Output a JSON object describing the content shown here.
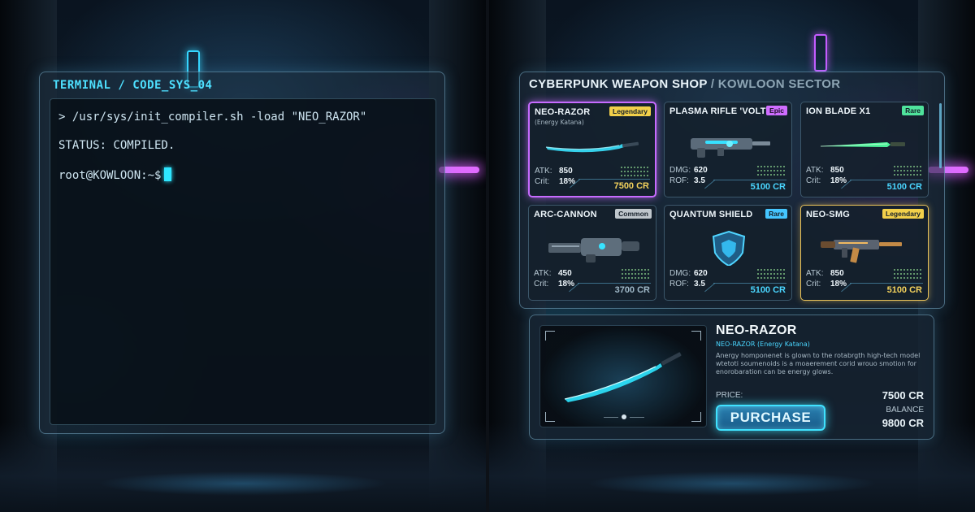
{
  "terminal": {
    "title": "TERMINAL / CODE_SYS_04",
    "lines": [
      "> /usr/sys/init_compiler.sh -load \"NEO_RAZOR\"",
      "STATUS: COMPILED.",
      "root@KOWLOON:~$"
    ]
  },
  "shop": {
    "title_main": "CYBERPUNK WEAPON SHOP",
    "title_sep": " / KOWLOON SECTOR",
    "items": [
      {
        "name": "NEO-RAZOR",
        "subtitle": "(Energy Katana)",
        "badge": "Legendary",
        "stat1_label": "ATK:",
        "stat1_value": "850",
        "stat2_label": "Crit:",
        "stat2_value": "18%",
        "price": "7500 CR",
        "icon": "katana-icon"
      },
      {
        "name": "PLASMA RIFLE 'VOLT'",
        "subtitle": "",
        "badge": "Epic",
        "stat1_label": "DMG:",
        "stat1_value": "620",
        "stat2_label": "ROF:",
        "stat2_value": "3.5",
        "price": "5100 CR",
        "icon": "rifle-icon"
      },
      {
        "name": "ION BLADE X1",
        "subtitle": "",
        "badge": "Rare",
        "stat1_label": "ATK:",
        "stat1_value": "850",
        "stat2_label": "Crit:",
        "stat2_value": "18%",
        "price": "5100 CR",
        "icon": "blade-icon"
      },
      {
        "name": "ARC-CANNON",
        "subtitle": "",
        "badge": "Common",
        "stat1_label": "ATK:",
        "stat1_value": "450",
        "stat2_label": "Crit:",
        "stat2_value": "18%",
        "price": "3700 CR",
        "icon": "cannon-icon"
      },
      {
        "name": "QUANTUM SHIELD",
        "subtitle": "",
        "badge": "Rare",
        "stat1_label": "DMG:",
        "stat1_value": "620",
        "stat2_label": "ROF:",
        "stat2_value": "3.5",
        "price": "5100 CR",
        "icon": "shield-icon"
      },
      {
        "name": "NEO-SMG",
        "subtitle": "",
        "badge": "Legendary",
        "stat1_label": "ATK:",
        "stat1_value": "850",
        "stat2_label": "Crit:",
        "stat2_value": "18%",
        "price": "5100 CR",
        "icon": "smg-icon"
      }
    ]
  },
  "detail": {
    "name": "NEO-RAZOR",
    "subtitle": "NEO-RAZOR (Energy Katana)",
    "description": "Anergy homponenet is glown to the rotabrgth high-tech model wtetoti soumenoids is a moaerement corid wrouo smotion for enorobaration can be energy glows.",
    "price_label": "PRICE:",
    "price": "7500 CR",
    "purchase_label": "PURCHASE",
    "balance_label": "BALANCE",
    "balance": "9800 CR"
  },
  "colors": {
    "accent_cyan": "#4ee0ff",
    "legendary": "#f2d04a",
    "epic": "#cf6dff",
    "rare_green": "#4fe39c",
    "rare_cyan": "#45c6ff",
    "common": "#bfc6cc"
  }
}
